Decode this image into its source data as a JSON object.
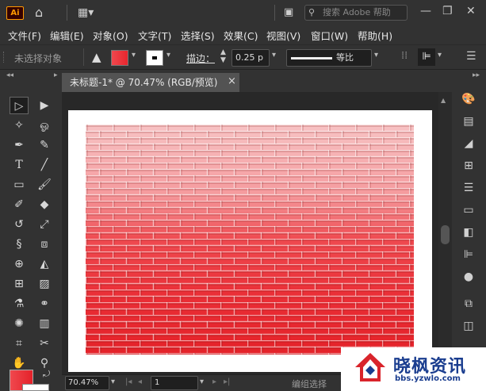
{
  "app": {
    "logo": "Ai"
  },
  "titlebar": {
    "search_placeholder": "搜索 Adobe 帮助"
  },
  "menu": [
    "文件(F)",
    "编辑(E)",
    "对象(O)",
    "文字(T)",
    "选择(S)",
    "效果(C)",
    "视图(V)",
    "窗口(W)",
    "帮助(H)"
  ],
  "control": {
    "selection_status": "未选择对象",
    "stroke_label": "描边：",
    "stroke_weight": "0.25 p",
    "stroke_profile": "等比"
  },
  "document": {
    "tab_title": "未标题-1* @ 70.47% (RGB/预览)",
    "close": "×"
  },
  "status": {
    "zoom": "70.47%",
    "artboard": "1",
    "mode": "编组选择"
  },
  "watermark": {
    "brand": "晓枫资讯",
    "url": "bbs.yzwlo.com"
  },
  "colors": {
    "fill": "#e8262e",
    "stroke": "#ffffff",
    "accent": "#ff9a00"
  }
}
